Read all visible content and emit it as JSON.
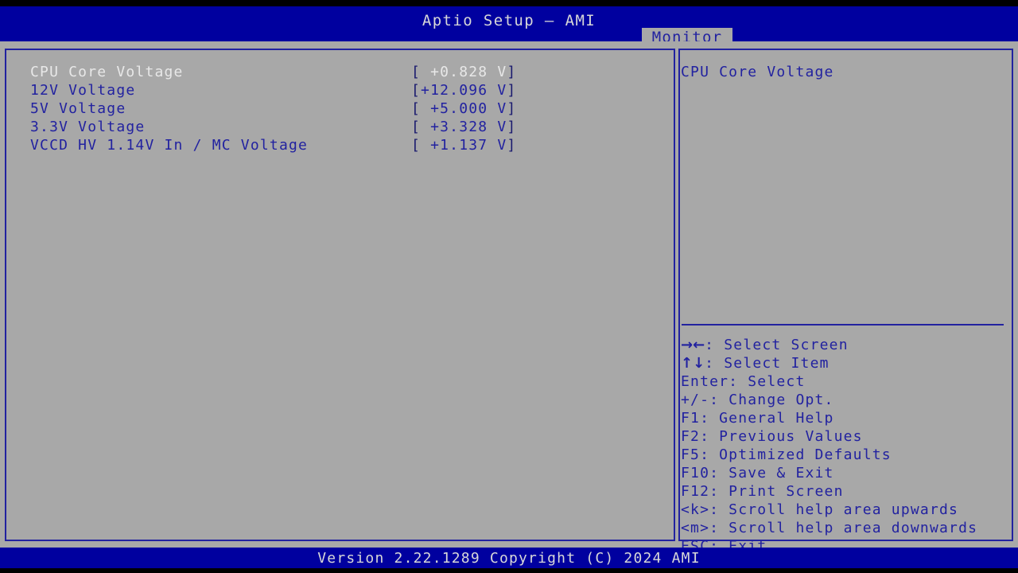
{
  "window": {
    "title": "Aptio Setup – AMI",
    "active_tab": "Monitor",
    "colors": {
      "header_blue": "#00009f",
      "body_gray": "#a8a8a8",
      "text_blue": "#2222a0",
      "text_selected": "#e8e8e8",
      "border_blue": "#2222a0"
    }
  },
  "tabs": [
    {
      "label": "Monitor",
      "active": true
    }
  ],
  "settings": [
    {
      "label": "CPU Core Voltage",
      "open_bracket": "[",
      "value": " +0.828 V",
      "close_bracket": "]",
      "selected": true
    },
    {
      "label": "12V Voltage",
      "open_bracket": "[",
      "value": "+12.096 V",
      "close_bracket": "]",
      "selected": false
    },
    {
      "label": "5V Voltage",
      "open_bracket": "[",
      "value": " +5.000 V",
      "close_bracket": "]",
      "selected": false
    },
    {
      "label": "3.3V Voltage",
      "open_bracket": "[",
      "value": " +3.328 V",
      "close_bracket": "]",
      "selected": false
    },
    {
      "label": "VCCD HV 1.14V In / MC Voltage",
      "open_bracket": "[",
      "value": " +1.137 V",
      "close_bracket": "]",
      "selected": false
    }
  ],
  "help": {
    "lines": [
      "CPU Core Voltage"
    ]
  },
  "legend": [
    {
      "keys": "→←",
      "text": ": Select Screen"
    },
    {
      "keys": "↑↓",
      "text": ": Select Item"
    },
    {
      "keys": "",
      "text": "Enter: Select"
    },
    {
      "keys": "",
      "text": "+/-: Change Opt."
    },
    {
      "keys": "",
      "text": "F1: General Help"
    },
    {
      "keys": "",
      "text": "F2: Previous Values"
    },
    {
      "keys": "",
      "text": "F5: Optimized Defaults"
    },
    {
      "keys": "",
      "text": "F10: Save & Exit"
    },
    {
      "keys": "",
      "text": "F12: Print Screen"
    },
    {
      "keys": "",
      "text": "<k>: Scroll help area upwards"
    },
    {
      "keys": "",
      "text": "<m>: Scroll help area downwards"
    },
    {
      "keys": "",
      "text": "ESC: Exit"
    }
  ],
  "footer": {
    "version_text": "Version 2.22.1289 Copyright (C) 2024 AMI"
  }
}
